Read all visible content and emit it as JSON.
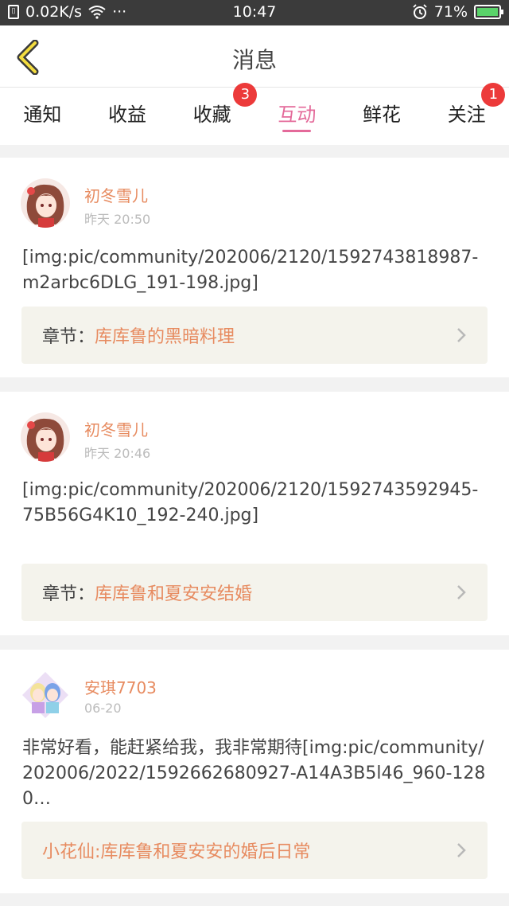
{
  "status": {
    "speed": "0.02K/s",
    "dots": "···",
    "time": "10:47",
    "battery": "71%"
  },
  "header": {
    "title": "消息"
  },
  "tabs": [
    {
      "label": "通知",
      "badge": ""
    },
    {
      "label": "收益",
      "badge": ""
    },
    {
      "label": "收藏",
      "badge": "3"
    },
    {
      "label": "互动",
      "badge": ""
    },
    {
      "label": "鲜花",
      "badge": ""
    },
    {
      "label": "关注",
      "badge": "1"
    }
  ],
  "messages": [
    {
      "user": "初冬雪儿",
      "time": "昨天 20:50",
      "content": "[img:pic/community/202006/2120/1592743818987-m2arbc6DLG_191-198.jpg]",
      "chapter_label": "章节：",
      "chapter_name": "库库鲁的黑暗料理"
    },
    {
      "user": "初冬雪儿",
      "time": "昨天 20:46",
      "content": "[img:pic/community/202006/2120/1592743592945-75B56G4K10_192-240.jpg]",
      "chapter_label": "章节：",
      "chapter_name": "库库鲁和夏安安结婚"
    },
    {
      "user": "安琪7703",
      "time": "06-20",
      "content": "非常好看，能赶紧给我，我非常期待[img:pic/community/202006/2022/1592662680927-A14A3B5l46_960-1280…",
      "chapter_label": "",
      "chapter_name": "小花仙:库库鲁和夏安安的婚后日常"
    }
  ],
  "colors": {
    "accent": "#e46a9a",
    "username": "#e78b60",
    "badge": "#ec3a3a"
  }
}
